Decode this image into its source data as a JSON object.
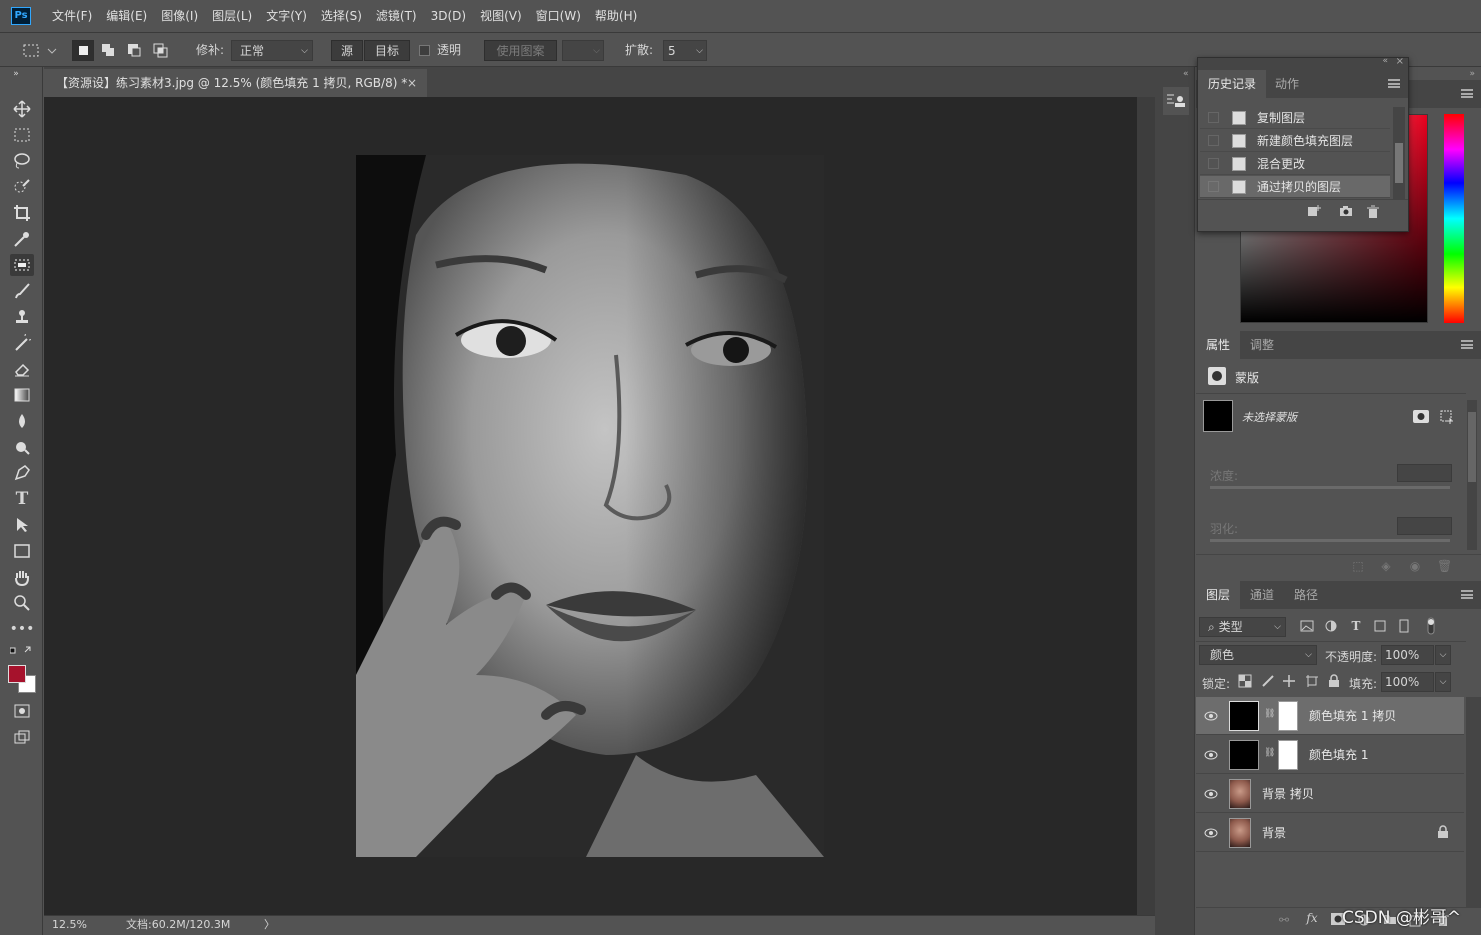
{
  "app": {
    "logo": "Ps"
  },
  "menu": [
    "文件(F)",
    "编辑(E)",
    "图像(I)",
    "图层(L)",
    "文字(Y)",
    "选择(S)",
    "滤镜(T)",
    "3D(D)",
    "视图(V)",
    "窗口(W)",
    "帮助(H)"
  ],
  "options": {
    "repair_label": "修补:",
    "repair_value": "正常",
    "source_label": "源",
    "target_label": "目标",
    "transparent_label": "透明",
    "use_pattern_label": "使用图案",
    "spread_label": "扩散:",
    "spread_value": "5"
  },
  "document": {
    "tab_title": "【资源设】练习素材3.jpg @ 12.5% (颜色填充 1 拷贝, RGB/8) *",
    "close_glyph": "×"
  },
  "status": {
    "zoom": "12.5%",
    "doc_info": "文档:60.2M/120.3M",
    "arrow": "〉"
  },
  "history_panel": {
    "tabs": [
      "历史记录",
      "动作"
    ],
    "items": [
      "复制图层",
      "新建颜色填充图层",
      "混合更改",
      "通过拷贝的图层"
    ],
    "active_index": 3
  },
  "properties_panel": {
    "tabs": [
      "属性",
      "调整"
    ],
    "section_label": "蒙版",
    "mask_label": "未选择蒙版",
    "density_label": "浓度:",
    "feather_label": "羽化:"
  },
  "layers_panel": {
    "tabs": [
      "图层",
      "通道",
      "路径"
    ],
    "filter_kind": "类型",
    "blend_mode": "颜色",
    "opacity_label": "不透明度:",
    "opacity_value": "100%",
    "lock_label": "锁定:",
    "fill_label": "填充:",
    "fill_value": "100%",
    "layers": [
      {
        "name": "颜色填充 1 拷贝",
        "type": "fill",
        "selected": true
      },
      {
        "name": "颜色填充 1",
        "type": "fill",
        "selected": false
      },
      {
        "name": "背景 拷贝",
        "type": "photo",
        "selected": false
      },
      {
        "name": "背景",
        "type": "photo",
        "selected": false,
        "locked": true
      }
    ],
    "fx_label": "fx"
  },
  "watermark": "CSDN @彬哥^",
  "colors": {
    "foreground": "#a6122c",
    "background": "#ffffff"
  }
}
